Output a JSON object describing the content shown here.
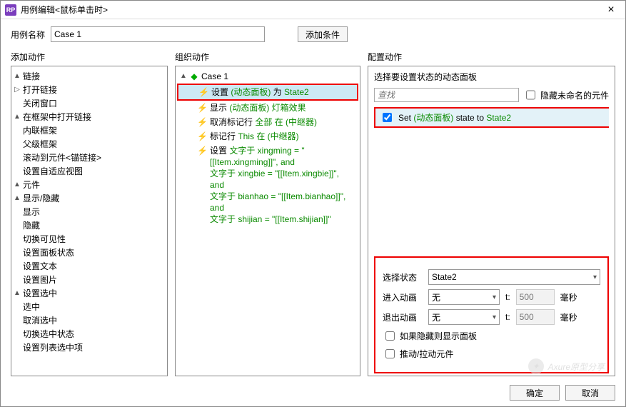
{
  "titlebar": {
    "logo": "RP",
    "title": "用例编辑<鼠标单击时>"
  },
  "caseName": {
    "label": "用例名称",
    "value": "Case 1",
    "addCond": "添加条件"
  },
  "columns": {
    "add": "添加动作",
    "org": "组织动作",
    "cfg": "配置动作"
  },
  "actionTree": [
    {
      "lvl": 0,
      "tw": "▲",
      "label": "链接"
    },
    {
      "lvl": 1,
      "tw": "▷",
      "label": "打开链接"
    },
    {
      "lvl": 1,
      "tw": "",
      "label": "关闭窗口"
    },
    {
      "lvl": 1,
      "tw": "▲",
      "label": "在框架中打开链接"
    },
    {
      "lvl": 2,
      "tw": "",
      "label": "内联框架"
    },
    {
      "lvl": 2,
      "tw": "",
      "label": "父级框架"
    },
    {
      "lvl": 1,
      "tw": "",
      "label": "滚动到元件<锚链接>"
    },
    {
      "lvl": 1,
      "tw": "",
      "label": "设置自适应视图"
    },
    {
      "lvl": 0,
      "tw": "▲",
      "label": "元件"
    },
    {
      "lvl": 1,
      "tw": "▲",
      "label": "显示/隐藏"
    },
    {
      "lvl": 2,
      "tw": "",
      "label": "显示"
    },
    {
      "lvl": 2,
      "tw": "",
      "label": "隐藏"
    },
    {
      "lvl": 2,
      "tw": "",
      "label": "切换可见性"
    },
    {
      "lvl": 1,
      "tw": "",
      "label": "设置面板状态"
    },
    {
      "lvl": 1,
      "tw": "",
      "label": "设置文本"
    },
    {
      "lvl": 1,
      "tw": "",
      "label": "设置图片"
    },
    {
      "lvl": 1,
      "tw": "▲",
      "label": "设置选中"
    },
    {
      "lvl": 2,
      "tw": "",
      "label": "选中"
    },
    {
      "lvl": 2,
      "tw": "",
      "label": "取消选中"
    },
    {
      "lvl": 2,
      "tw": "",
      "label": "切换选中状态"
    },
    {
      "lvl": 1,
      "tw": "",
      "label": "设置列表选中项"
    }
  ],
  "org": {
    "caseLabel": "Case 1",
    "actions": {
      "a1": {
        "pre": "设置 ",
        "g1": "(动态面板)",
        "mid": " 为 ",
        "g2": "State2"
      },
      "a2": {
        "pre": "显示 ",
        "g1": "(动态面板) 灯箱效果"
      },
      "a3": {
        "pre": "取消标记行 ",
        "g1": "全部 在 (中继器)"
      },
      "a4": {
        "pre": "标记行 ",
        "g1": "This 在 (中继器)"
      },
      "a5": {
        "pre": "设置 ",
        "l1": "文字于 xingming = \"[[Item.xingming]]\", and",
        "l2": "文字于 xingbie = \"[[Item.xingbie]]\", and",
        "l3": "文字于 bianhao = \"[[Item.bianhao]]\", and",
        "l4": "文字于 shijian = \"[[Item.shijian]]\""
      }
    }
  },
  "cfg": {
    "topLabel": "选择要设置状态的动态面板",
    "searchPlaceholder": "查找",
    "hideUnnamed": "隐藏未命名的元件",
    "found": {
      "pre": "Set ",
      "g1": "(动态面板)",
      "mid": " state to ",
      "g2": "State2"
    },
    "form": {
      "stateLabel": "选择状态",
      "stateVal": "State2",
      "inLabel": "进入动画",
      "outLabel": "退出动画",
      "animVal": "无",
      "t": "t:",
      "ms": "500",
      "msUnit": "毫秒",
      "chk1": "如果隐藏则显示面板",
      "chk2": "推动/拉动元件"
    }
  },
  "footer": {
    "ok": "确定",
    "cancel": "取消"
  },
  "watermark": "Axure原型分享"
}
